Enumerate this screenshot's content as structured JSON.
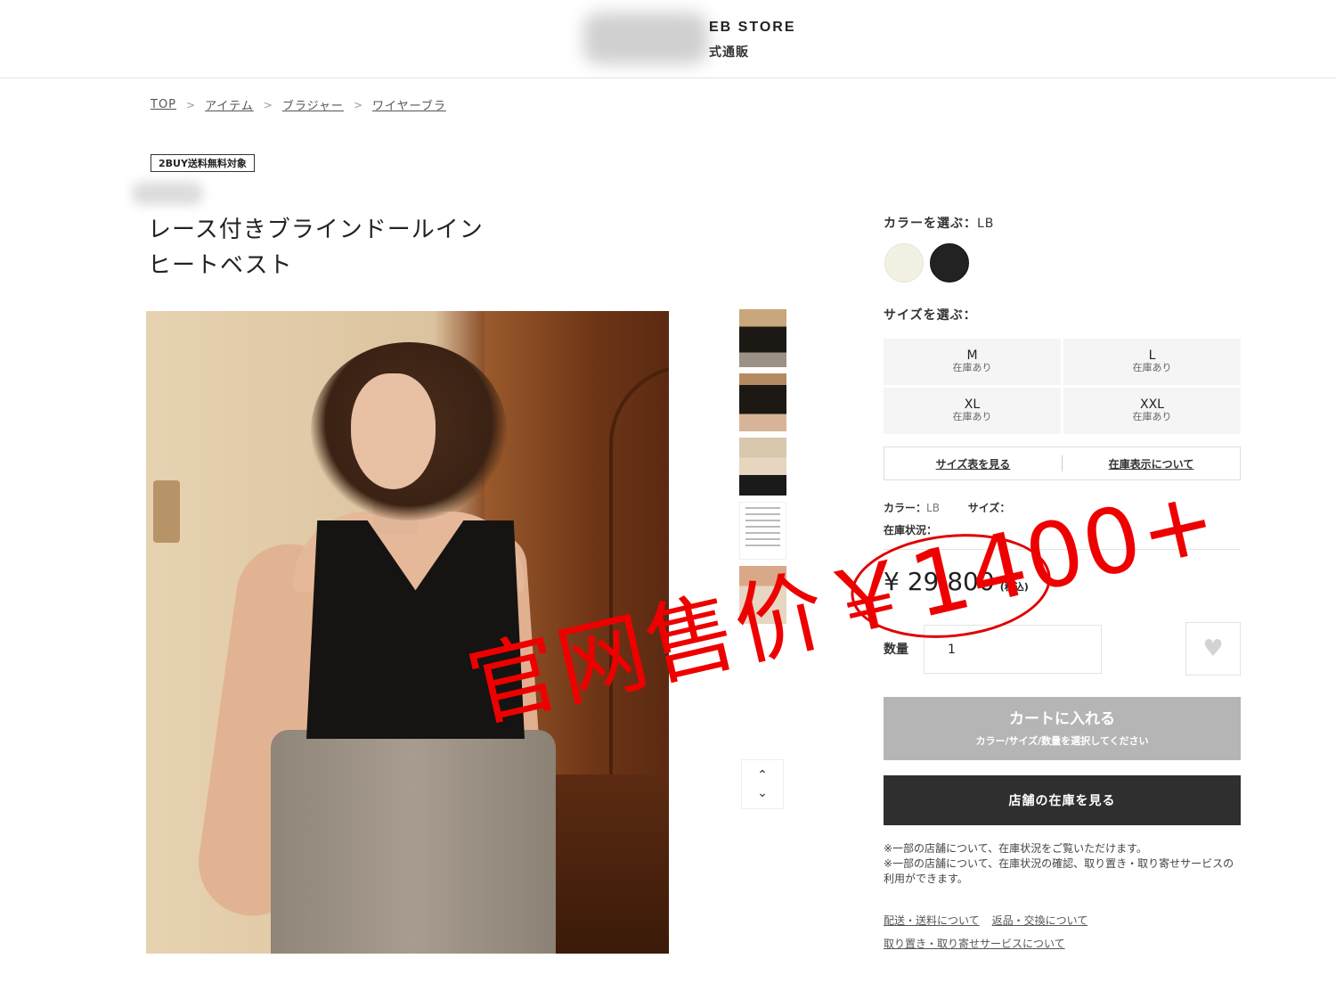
{
  "header": {
    "store_name": "EB STORE",
    "store_sub": "式通販"
  },
  "breadcrumb": [
    "TOP",
    "アイテム",
    "ブラジャー",
    "ワイヤーブラ"
  ],
  "badge": "2BUY送料無料対象",
  "product": {
    "title_line1": "レース付きブラインドールイン",
    "title_line2": "ヒートベスト"
  },
  "color": {
    "label": "カラーを選ぶ：",
    "selected": "LB",
    "swatches": [
      {
        "name": "white",
        "hex": "#f3f0e4"
      },
      {
        "name": "black",
        "hex": "#222222"
      }
    ]
  },
  "size": {
    "label": "サイズを選ぶ：",
    "options": [
      {
        "size": "M",
        "stock": "在庫あり"
      },
      {
        "size": "L",
        "stock": "在庫あり"
      },
      {
        "size": "XL",
        "stock": "在庫あり"
      },
      {
        "size": "XXL",
        "stock": "在庫あり"
      }
    ],
    "chart_link": "サイズ表を見る",
    "stock_link": "在庫表示について"
  },
  "selection": {
    "color_key": "カラー：",
    "color_value": "LB",
    "size_key": "サイズ：",
    "stock_key": "在庫状況："
  },
  "price": {
    "amount": "¥ 29,800",
    "tax": "(税込)"
  },
  "quantity": {
    "label": "数量",
    "value": "1"
  },
  "buttons": {
    "fav_icon": "heart-icon",
    "cart_main": "カートに入れる",
    "cart_sub": "カラー/サイズ/数量を選択してください",
    "store_stock": "店舗の在庫を見る"
  },
  "notes": [
    "※一部の店舗について、在庫状況をご覧いただけます。",
    "※一部の店舗について、在庫状況の確認、取り置き・取り寄せサービスの利用ができます。"
  ],
  "footer_links": [
    "配送・送料について",
    "返品・交換について",
    "取り置き・取り寄せサービスについて"
  ],
  "annotation": {
    "text": "官网售价￥1400+",
    "color": "#ee0000"
  }
}
